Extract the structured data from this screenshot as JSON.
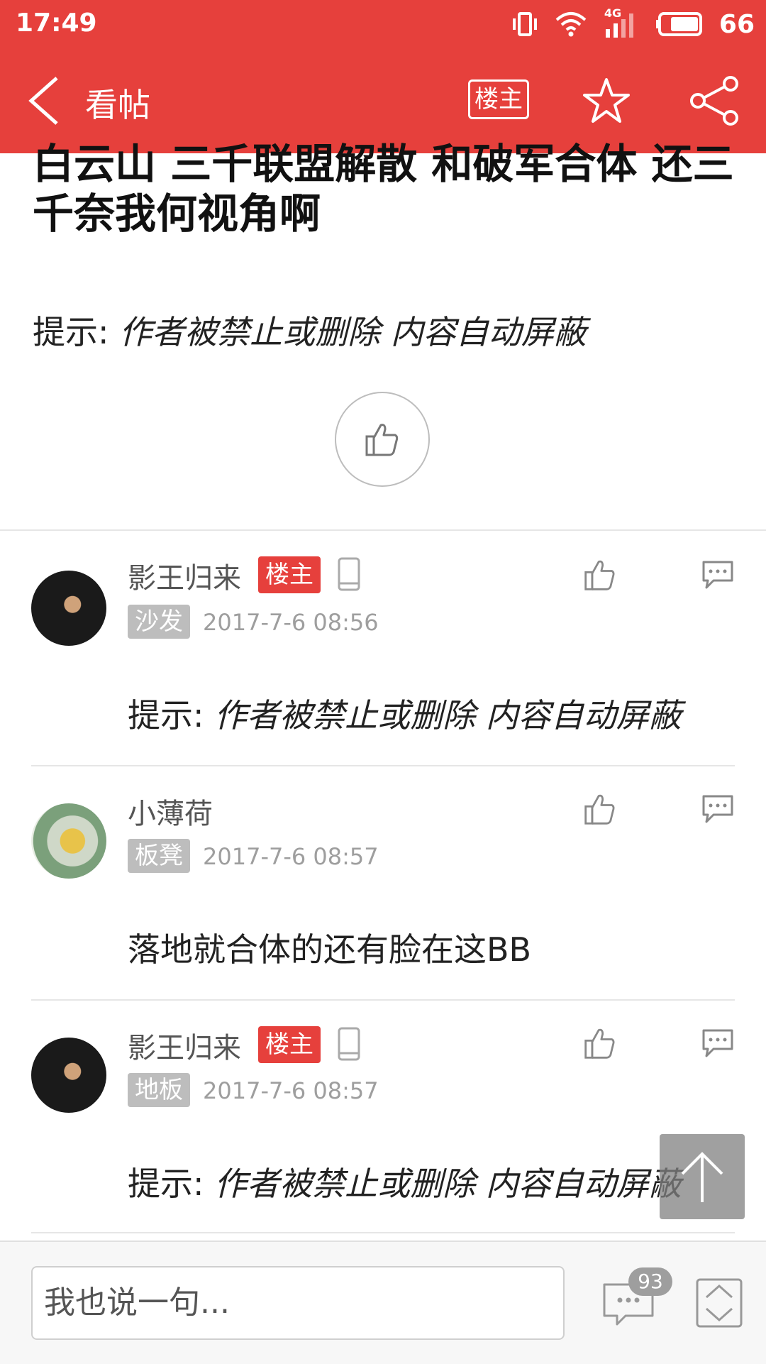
{
  "status_bar": {
    "time": "17:49",
    "network": "4G",
    "battery": "66"
  },
  "app_bar": {
    "title": "看帖",
    "owner_only_label": "楼主"
  },
  "post": {
    "title": "白云山 三千联盟解散 和破军合体 还三千奈我何视角啊",
    "notice_label": "提示:",
    "notice_message": "作者被禁止或删除 内容自动屏蔽"
  },
  "replies": [
    {
      "author": "影王归来",
      "owner_tag": "楼主",
      "floor": "沙发",
      "time": "2017-7-6 08:56",
      "notice_label": "提示:",
      "notice_message": "作者被禁止或删除 内容自动屏蔽"
    },
    {
      "author": "小薄荷",
      "floor": "板凳",
      "time": "2017-7-6 08:57",
      "text": "落地就合体的还有脸在这BB"
    },
    {
      "author": "影王归来",
      "owner_tag": "楼主",
      "floor": "地板",
      "time": "2017-7-6 08:57",
      "notice_label": "提示:",
      "notice_message": "作者被禁止或删除 内容自动屏蔽"
    }
  ],
  "bottom_bar": {
    "input_placeholder": "我也说一句...",
    "comment_count": "93"
  },
  "colors": {
    "accent": "#e6403c",
    "tag_gray": "#bdbdbd",
    "text_muted": "#9e9e9e"
  }
}
